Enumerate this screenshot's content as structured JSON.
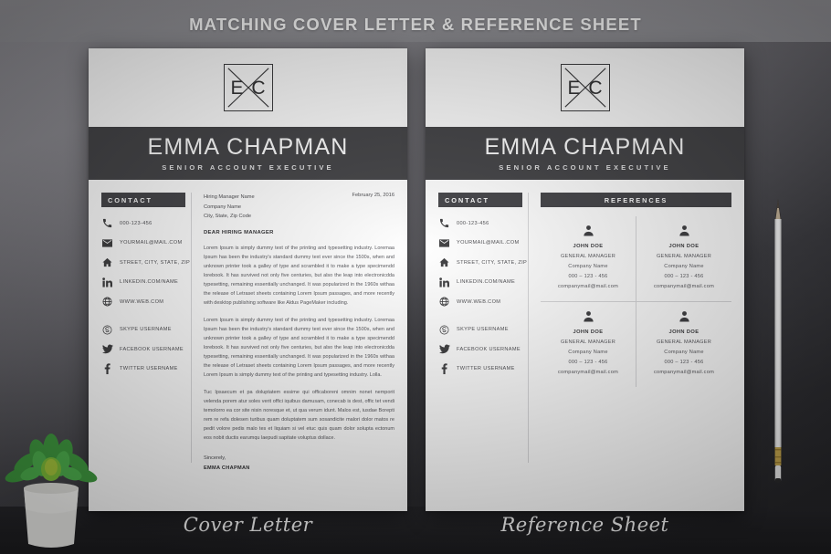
{
  "banner": {
    "title": "MATCHING COVER LETTER & REFERENCE SHEET"
  },
  "theme": {
    "dark_band": "#414144",
    "page_white": "#ffffff",
    "backdrop_light": "#909095",
    "backdrop_dark": "#242427",
    "text_gray": "#55555a"
  },
  "brand": {
    "monogram_left": "E",
    "monogram_right": "C",
    "name": "EMMA CHAPMAN",
    "job_title": "SENIOR ACCOUNT EXECUTIVE"
  },
  "contact": {
    "heading": "CONTACT",
    "items": [
      {
        "icon": "phone-icon",
        "label": "000-123-456"
      },
      {
        "icon": "envelope-icon",
        "label": "YOURMAIL@MAIL.COM"
      },
      {
        "icon": "home-icon",
        "label": "STREET, CITY, STATE, ZIP"
      },
      {
        "icon": "linkedin-icon",
        "label": "LINKEDIN.COM/NAME"
      },
      {
        "icon": "globe-icon",
        "label": "WWW.WEB.COM"
      }
    ],
    "social": [
      {
        "icon": "skype-icon",
        "label": "SKYPE USERNAME"
      },
      {
        "icon": "twitter-icon",
        "label": "FACEBOOK USERNAME"
      },
      {
        "icon": "facebook-icon",
        "label": "TWITTER USERNAME"
      }
    ]
  },
  "cover_letter": {
    "recipient_line1": "Hiring Manager Name",
    "recipient_line2": "Company Name",
    "recipient_line3": "City, State, Zip Code",
    "date": "February 25, 2016",
    "salutation": "DEAR HIRING MANAGER",
    "paragraph1": "Lorem Ipsum is simply dummy text of the printing and typesetting industry. Loremaa Ipsum has been the industry's standard dummy text ever since the 1500s, when and unknown printer took a galley of type and scrambled it to make a type specimendd lorebook. It has survived not only five centuries, but also the leap into electronicdda typesetting, remaining essentially unchanged. It was popularized in the 1960s withaa the release of Letraset sheets containing Lorem Ipsum passages, and more recently with desktop publishing software like Aldus PageMaker including.",
    "paragraph2": "Lorem Ipsum is simply dummy text of the printing and typesetting industry. Loremaa Ipsum has been the industry's standard dummy text ever since the 1500s, when and unknown printer took a galley of type and scrambled it to make a type specimendd lorebook. It has survived not only five centuries, but also the leap into electronicdda typesetting, remaining essentially unchanged. It was popularized in the 1960s withaa the release of Letraset sheets containing Lorem Ipsum passages, and more recently Lorem Ipsum is simply dummy text of the printing and typesetting industry. Lolla.",
    "paragraph3": "Tuc Ipsaecum et pa doluptatem essime qui officaboreni omnim nonet nemporit velenda porem atur soles verit offici iquibus damusam, conecab is dest, offic tet vendi temolorro ea cor site nisin noresque et, ut qua verum idunt. Malos est, iusdae Borepti rem re refa dolesen turibus quam doluptatem sum sosandicite malori dolor matos re pedit volore pedis malo tes et liquiam si vel etuc quis quam dolor solupta ectonum eos nobit ductis earumqu laepudi sapitate voluptus dollace.",
    "closing": "Sincerely,",
    "signature": "EMMA CHAPMAN"
  },
  "reference_sheet": {
    "heading": "REFERENCES",
    "entries": [
      {
        "name": "JOHN DOE",
        "role": "GENERAL MANAGER",
        "company": "Company Name",
        "phone": "000 – 123 - 456",
        "email": "companymail@mail.com"
      },
      {
        "name": "JOHN DOE",
        "role": "GENERAL MANAGER",
        "company": "Company Name",
        "phone": "000 – 123 - 456",
        "email": "companymail@mail.com"
      },
      {
        "name": "JOHN DOE",
        "role": "GENERAL MANAGER",
        "company": "Company Name",
        "phone": "000 – 123 - 456",
        "email": "companymail@mail.com"
      },
      {
        "name": "JOHN DOE",
        "role": "GENERAL MANAGER",
        "company": "Company Name",
        "phone": "000 – 123 - 456",
        "email": "companymail@mail.com"
      }
    ]
  },
  "captions": {
    "cover": "Cover Letter",
    "reference": "Reference Sheet"
  },
  "props": {
    "plant": "succulent-plant",
    "pencil": "white-pencil"
  }
}
